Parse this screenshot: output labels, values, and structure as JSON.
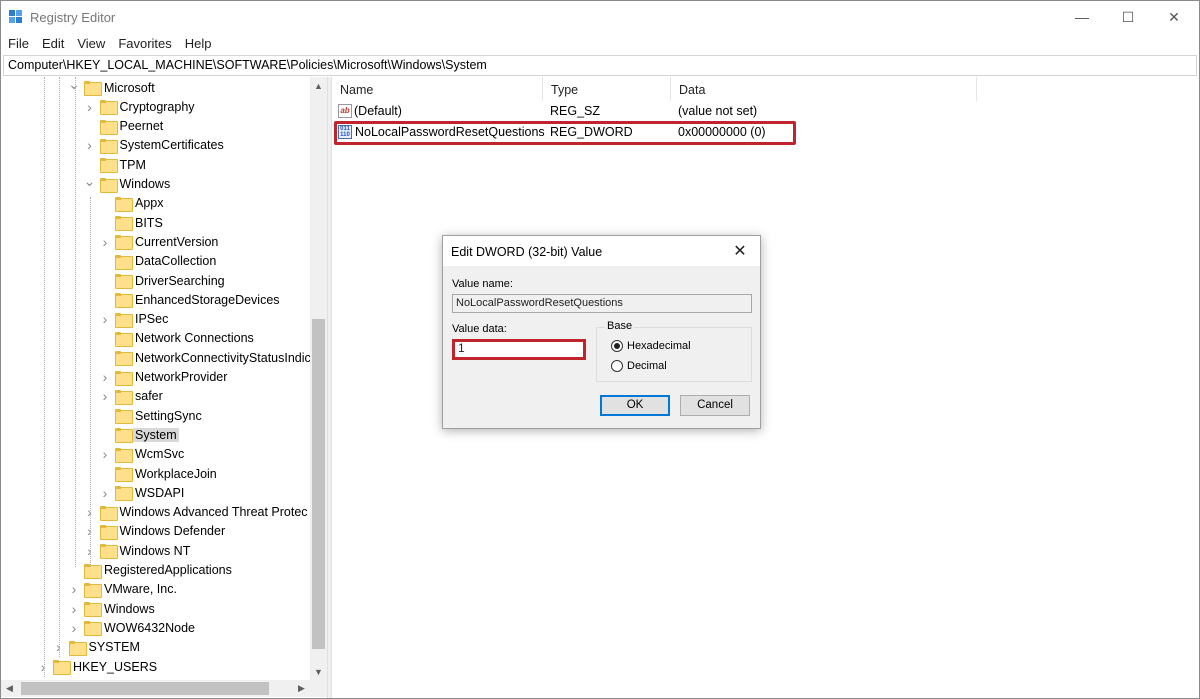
{
  "window": {
    "title": "Registry Editor",
    "controls": {
      "minimize": "—",
      "maximize": "☐",
      "close": "✕"
    }
  },
  "menu": [
    "File",
    "Edit",
    "View",
    "Favorites",
    "Help"
  ],
  "address": "Computer\\HKEY_LOCAL_MACHINE\\SOFTWARE\\Policies\\Microsoft\\Windows\\System",
  "tree": [
    {
      "label": "Microsoft",
      "level": 2,
      "expander": "open"
    },
    {
      "label": "Cryptography",
      "level": 3,
      "expander": "closed"
    },
    {
      "label": "Peernet",
      "level": 3,
      "expander": "none"
    },
    {
      "label": "SystemCertificates",
      "level": 3,
      "expander": "closed"
    },
    {
      "label": "TPM",
      "level": 3,
      "expander": "none"
    },
    {
      "label": "Windows",
      "level": 3,
      "expander": "open"
    },
    {
      "label": "Appx",
      "level": 4,
      "expander": "none"
    },
    {
      "label": "BITS",
      "level": 4,
      "expander": "none"
    },
    {
      "label": "CurrentVersion",
      "level": 4,
      "expander": "closed"
    },
    {
      "label": "DataCollection",
      "level": 4,
      "expander": "none"
    },
    {
      "label": "DriverSearching",
      "level": 4,
      "expander": "none"
    },
    {
      "label": "EnhancedStorageDevices",
      "level": 4,
      "expander": "none"
    },
    {
      "label": "IPSec",
      "level": 4,
      "expander": "closed"
    },
    {
      "label": "Network Connections",
      "level": 4,
      "expander": "none"
    },
    {
      "label": "NetworkConnectivityStatusIndic",
      "level": 4,
      "expander": "none"
    },
    {
      "label": "NetworkProvider",
      "level": 4,
      "expander": "closed"
    },
    {
      "label": "safer",
      "level": 4,
      "expander": "closed"
    },
    {
      "label": "SettingSync",
      "level": 4,
      "expander": "none"
    },
    {
      "label": "System",
      "level": 4,
      "expander": "none",
      "selected": true
    },
    {
      "label": "WcmSvc",
      "level": 4,
      "expander": "closed"
    },
    {
      "label": "WorkplaceJoin",
      "level": 4,
      "expander": "none"
    },
    {
      "label": "WSDAPI",
      "level": 4,
      "expander": "closed"
    },
    {
      "label": "Windows Advanced Threat Protec",
      "level": 3,
      "expander": "closed"
    },
    {
      "label": "Windows Defender",
      "level": 3,
      "expander": "closed"
    },
    {
      "label": "Windows NT",
      "level": 3,
      "expander": "closed"
    },
    {
      "label": "RegisteredApplications",
      "level": 2,
      "expander": "none"
    },
    {
      "label": "VMware, Inc.",
      "level": 2,
      "expander": "closed"
    },
    {
      "label": "Windows",
      "level": 2,
      "expander": "closed"
    },
    {
      "label": "WOW6432Node",
      "level": 2,
      "expander": "closed"
    },
    {
      "label": "SYSTEM",
      "level": 1,
      "expander": "closed"
    },
    {
      "label": "HKEY_USERS",
      "level": 0,
      "expander": "closed"
    }
  ],
  "list": {
    "columns": [
      "Name",
      "Type",
      "Data"
    ],
    "rows": [
      {
        "icon": "string-value-icon",
        "name": "(Default)",
        "type": "REG_SZ",
        "data": "(value not set)"
      },
      {
        "icon": "binary-value-icon",
        "name": "NoLocalPasswordResetQuestions",
        "type": "REG_DWORD",
        "data": "0x00000000 (0)"
      }
    ]
  },
  "dialog": {
    "title": "Edit DWORD (32-bit) Value",
    "value_name_label": "Value name:",
    "value_name": "NoLocalPasswordResetQuestions",
    "value_data_label": "Value data:",
    "value_data": "1",
    "base_label": "Base",
    "base_options": [
      {
        "label": "Hexadecimal",
        "selected": true
      },
      {
        "label": "Decimal",
        "selected": false
      }
    ],
    "ok_label": "OK",
    "cancel_label": "Cancel",
    "close": "✕"
  },
  "colors": {
    "highlight": "#c0252e",
    "selection": "#d9d9d9",
    "default_button_border": "#0078d7"
  }
}
